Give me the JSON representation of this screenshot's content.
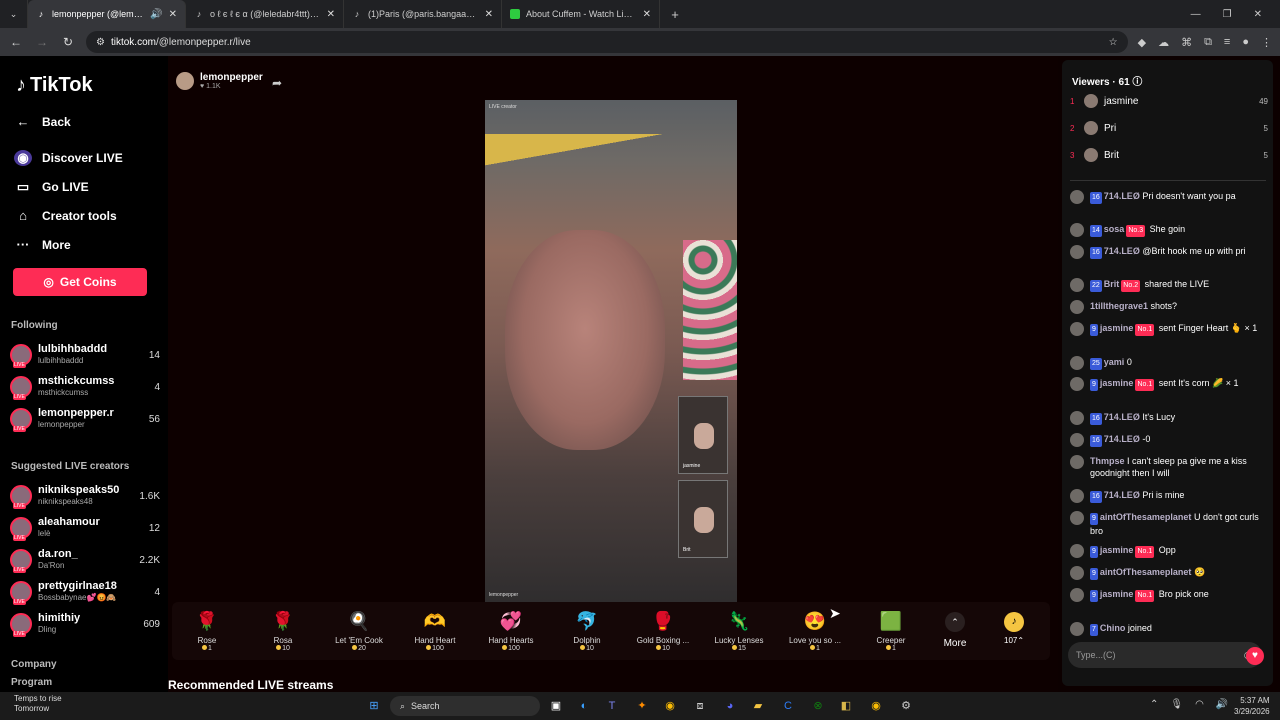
{
  "browser": {
    "tabs": [
      {
        "title": "lemonpepper (@lemonpepper.r)",
        "favicon": "tiktok-icon",
        "active": true
      },
      {
        "title": "ο ℓ є ℓ є α (@leledabr4ttt) | TikTok",
        "favicon": "tiktok-icon",
        "active": false
      },
      {
        "title": "(1)Paris (@paris.bangaa2) | TikTok",
        "favicon": "tiktok-icon",
        "active": false
      },
      {
        "title": "About Cuffem - Watch Live on TikTok",
        "favicon": "cuffem-icon",
        "active": false
      }
    ],
    "new_tab": "+",
    "url_host": "tiktok.com",
    "url_path": "/@lemonpepper.r/live"
  },
  "sidebar": {
    "logo": "TikTok",
    "nav": [
      {
        "label": "Back",
        "icon": "arrow-left-icon"
      },
      {
        "label": "Discover LIVE",
        "icon": "discover-live-icon"
      },
      {
        "label": "Go LIVE",
        "icon": "camera-icon"
      },
      {
        "label": "Creator tools",
        "icon": "home-icon"
      },
      {
        "label": "More",
        "icon": "ellipsis-icon"
      }
    ],
    "get_coins": "Get Coins",
    "following_title": "Following",
    "following": [
      {
        "name": "lulbihhbaddd",
        "handle": "lulbihhbaddd",
        "count": "14"
      },
      {
        "name": "msthickcumss",
        "handle": "msthickcumss",
        "count": "4"
      },
      {
        "name": "lemonpepper.r",
        "handle": "lemonpepper",
        "count": "56"
      }
    ],
    "suggested_title": "Suggested LIVE creators",
    "suggested": [
      {
        "name": "niknikspeaks50",
        "handle": "niknikspeaks48",
        "count": "1.6K"
      },
      {
        "name": "aleahamour",
        "handle": "lelè",
        "count": "12"
      },
      {
        "name": "da.ron_",
        "handle": "Da'Ron",
        "count": "2.2K"
      },
      {
        "name": "prettygirlnae18",
        "handle": "Bossbabynae💕😡🙈",
        "count": "4"
      },
      {
        "name": "himithiy",
        "handle": "Dling",
        "count": "609"
      }
    ],
    "footer": [
      "Company",
      "Program"
    ],
    "live_badge": "LIVE"
  },
  "stream": {
    "host_name": "lemonpepper",
    "host_likes": "♥ 1.1K",
    "video_tag": "LIVE creator",
    "video_watermark": "lemonpepper",
    "guests": [
      {
        "name": "jasmine"
      },
      {
        "name": "Brit"
      }
    ],
    "recommended_title": "Recommended LIVE streams"
  },
  "gifts": [
    {
      "name": "Rose",
      "price": "1",
      "emoji": "🌹"
    },
    {
      "name": "Rosa",
      "price": "10",
      "emoji": "🌹"
    },
    {
      "name": "Let 'Em Cook",
      "price": "20",
      "emoji": "🍳"
    },
    {
      "name": "Hand Heart",
      "price": "100",
      "emoji": "🫶"
    },
    {
      "name": "Hand Hearts",
      "price": "100",
      "emoji": "💞"
    },
    {
      "name": "Dolphin",
      "price": "10",
      "emoji": "🐬"
    },
    {
      "name": "Gold Boxing ...",
      "price": "10",
      "emoji": "🥊"
    },
    {
      "name": "Lucky Lenses",
      "price": "15",
      "emoji": "🦎"
    },
    {
      "name": "Love you so ...",
      "price": "1",
      "emoji": "😍"
    },
    {
      "name": "Creeper",
      "price": "1",
      "emoji": "🟩"
    }
  ],
  "gifts_more": "More",
  "coin_balance": "107⌃",
  "chat": {
    "viewers_title": "Viewers · 61",
    "top_viewers": [
      {
        "rank": "1",
        "name": "jasmine",
        "score": "49"
      },
      {
        "rank": "2",
        "name": "Pri",
        "score": "5"
      },
      {
        "rank": "3",
        "name": "Brit",
        "score": "5"
      }
    ],
    "messages": [
      {
        "lvl": "16",
        "user": "714.LEØ",
        "badge": "",
        "text": "Pri doesn't want you pa"
      },
      {
        "lvl": "14",
        "user": "sosa",
        "badge": "No.3",
        "text": "She goin"
      },
      {
        "lvl": "16",
        "user": "714.LEØ",
        "badge": "",
        "text": "@Brit hook me up with pri"
      },
      {
        "lvl": "22",
        "user": "Brit",
        "badge": "No.2",
        "text": "shared the LIVE"
      },
      {
        "lvl": "",
        "user": "1tillthegrave1",
        "badge": "",
        "text": "shots?"
      },
      {
        "lvl": "9",
        "user": "jasmine",
        "badge": "No.1",
        "text": "sent Finger Heart 🫰 × 1"
      },
      {
        "lvl": "25",
        "user": "yami",
        "badge": "",
        "text": "0"
      },
      {
        "lvl": "9",
        "user": "jasmine",
        "badge": "No.1",
        "text": "sent It's corn 🌽 × 1"
      },
      {
        "lvl": "16",
        "user": "714.LEØ",
        "badge": "",
        "text": "It's Lucy"
      },
      {
        "lvl": "16",
        "user": "714.LEØ",
        "badge": "",
        "text": "-0"
      },
      {
        "lvl": "",
        "user": "Thmpse",
        "badge": "",
        "text": "I can't sleep pa give me a kiss goodnight then I will"
      },
      {
        "lvl": "16",
        "user": "714.LEØ",
        "badge": "",
        "text": "Pri is mine"
      },
      {
        "lvl": "9",
        "user": "aintOfThesameplanet",
        "badge": "",
        "text": "U don't got curls bro"
      },
      {
        "lvl": "9",
        "user": "jasmine",
        "badge": "No.1",
        "text": "Opp"
      },
      {
        "lvl": "9",
        "user": "aintOfThesameplanet",
        "badge": "",
        "text": "🥺"
      },
      {
        "lvl": "9",
        "user": "jasmine",
        "badge": "No.1",
        "text": "Bro pick one"
      },
      {
        "lvl": "7",
        "user": "Chino",
        "badge": "",
        "text": "joined"
      }
    ],
    "input_placeholder": "Type...(C)"
  },
  "taskbar": {
    "weather_line1": "Temps to rise",
    "weather_line2": "Tomorrow",
    "search_label": "Search",
    "time": "5:37 AM",
    "date": "3/29/2026"
  },
  "colors": {
    "accent": "#fe2c55",
    "coin": "#f5c542"
  }
}
